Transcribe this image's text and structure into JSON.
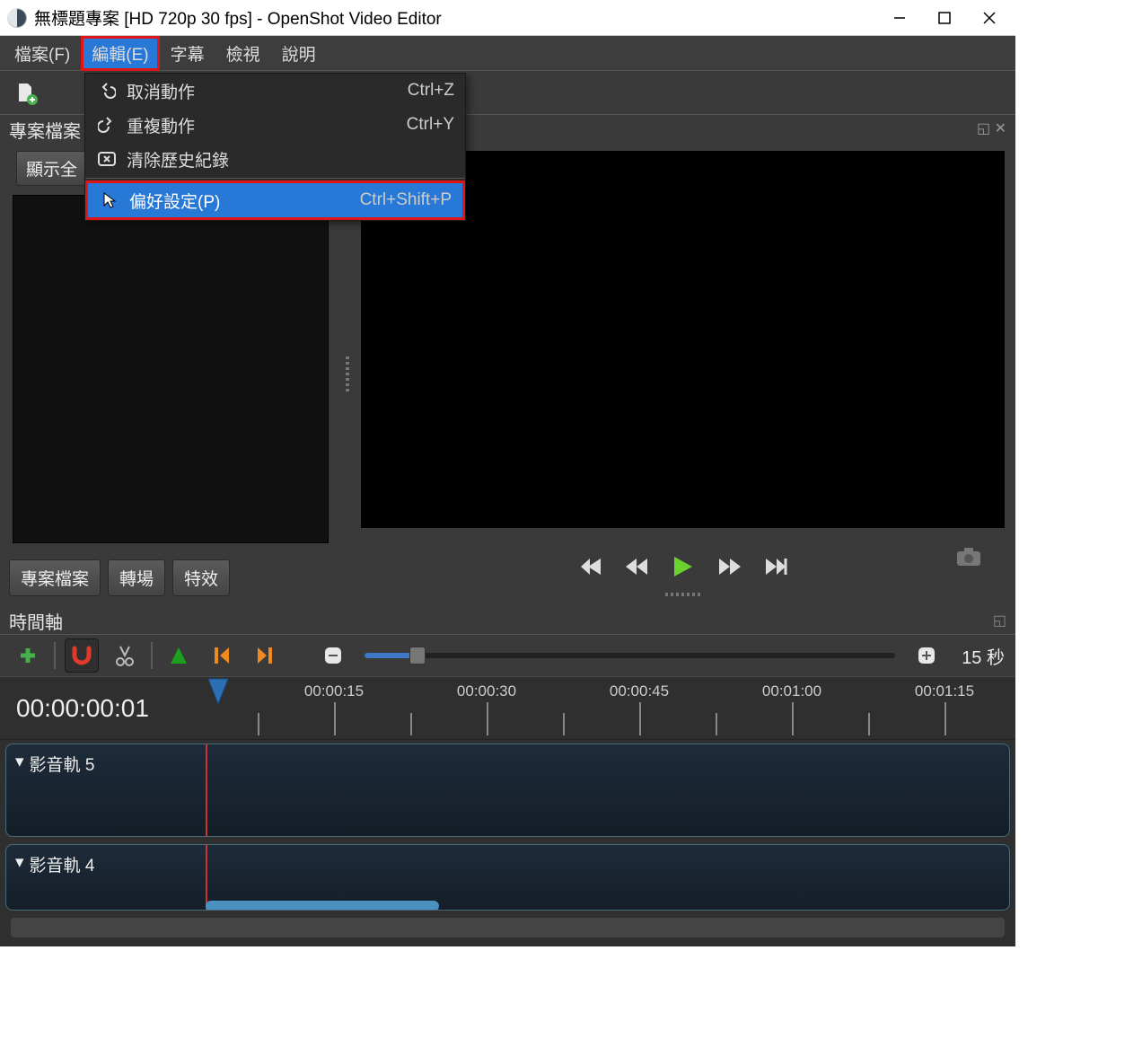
{
  "window_title": "無標題專案 [HD 720p 30 fps] - OpenShot Video Editor",
  "menus": {
    "file": "檔案(F)",
    "edit": "編輯(E)",
    "caption": "字幕",
    "view": "檢視",
    "help": "說明"
  },
  "edit_menu": {
    "undo": {
      "label": "取消動作",
      "accel": "Ctrl+Z"
    },
    "redo": {
      "label": "重複動作",
      "accel": "Ctrl+Y"
    },
    "clear": {
      "label": "清除歷史紀錄",
      "accel": ""
    },
    "prefs": {
      "label": "偏好設定(P)",
      "accel": "Ctrl+Shift+P"
    }
  },
  "project_panel_title": "專案檔案",
  "filter_button": "顯示全",
  "tabs": {
    "project": "專案檔案",
    "transition": "轉場",
    "effects": "特效"
  },
  "timeline_title": "時間軸",
  "timeline_duration": "15 秒",
  "timeline_counter": "00:00:00:01",
  "ruler_labels": [
    "00:00:15",
    "00:00:30",
    "00:00:45",
    "00:01:00",
    "00:01:15"
  ],
  "tracks": {
    "t1": "影音軌 5",
    "t2": "影音軌 4"
  }
}
